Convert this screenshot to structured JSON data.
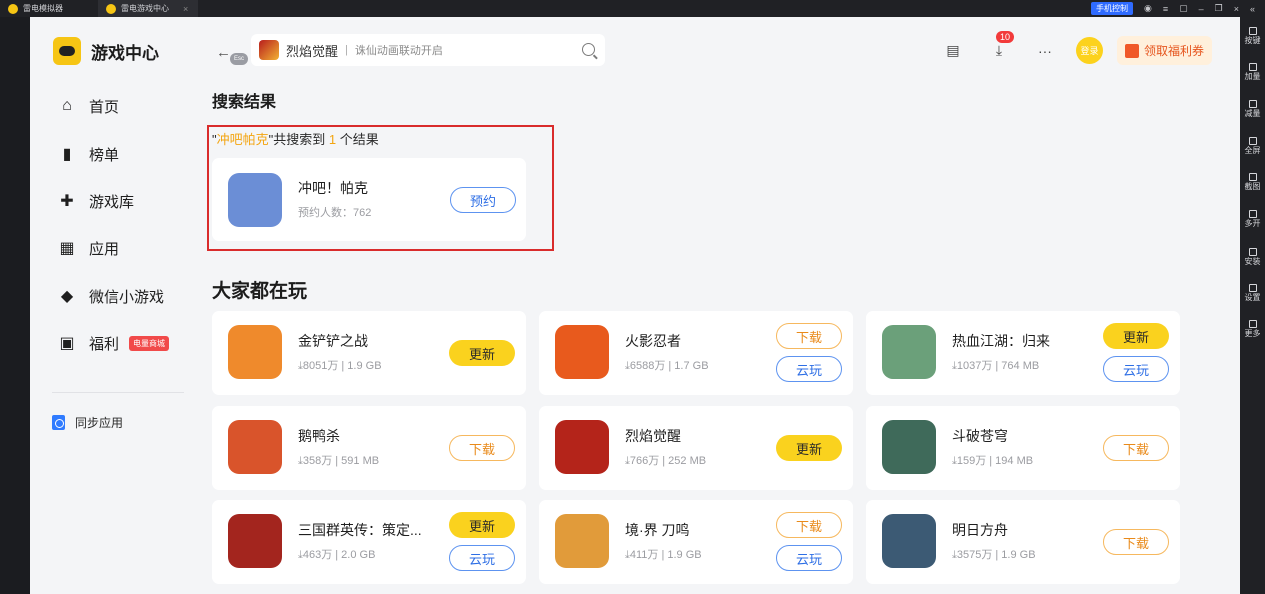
{
  "titlebar": {
    "tab1": "雷电模拟器",
    "tab2": "雷电游戏中心",
    "phone_control": "手机控制"
  },
  "rightbar": {
    "items": [
      "按键",
      "加量",
      "减量",
      "全屏",
      "截图",
      "多开",
      "安装",
      "设置",
      "更多"
    ]
  },
  "sidebar": {
    "brand": "游戏中心",
    "items": [
      {
        "label": "首页",
        "icon": "home-icon"
      },
      {
        "label": "榜单",
        "icon": "ranking-icon"
      },
      {
        "label": "游戏库",
        "icon": "gamepad-icon"
      },
      {
        "label": "应用",
        "icon": "apps-icon"
      },
      {
        "label": "微信小游戏",
        "icon": "wechat-game-icon"
      },
      {
        "label": "福利",
        "icon": "gift-icon",
        "badge": "电量商城"
      }
    ],
    "sync_label": "同步应用"
  },
  "header": {
    "back_hint": "Esc",
    "search_game": "烈焰觉醒",
    "search_divider": "|",
    "search_sub": "诛仙动画联动开启",
    "download_count": "10",
    "login_label": "登录",
    "welfare_label": "领取福利券"
  },
  "search_results": {
    "title": "搜索结果",
    "note_prefix": "\"",
    "query": "冲吧帕克",
    "note_mid": "\"共搜索到 ",
    "count": "1",
    "note_suffix": " 个结果",
    "item": {
      "name": "冲吧！帕克",
      "meta": "预约人数：762",
      "button": "预约",
      "icon_color": "#6b8ed6"
    }
  },
  "popular": {
    "title": "大家都在玩",
    "games": [
      {
        "name": "金铲铲之战",
        "meta": "⤓8051万 | 1.9 GB",
        "buttons": [
          "更新"
        ],
        "color": "#ef8a2c"
      },
      {
        "name": "火影忍者",
        "meta": "⤓6588万 | 1.7 GB",
        "buttons": [
          "下载",
          "云玩"
        ],
        "color": "#e85a1d"
      },
      {
        "name": "热血江湖：归来",
        "meta": "⤓1037万 | 764 MB",
        "buttons": [
          "更新",
          "云玩"
        ],
        "color": "#6ba07a"
      },
      {
        "name": "鹅鸭杀",
        "meta": "⤓358万 | 591 MB",
        "buttons": [
          "下载"
        ],
        "color": "#d9542b"
      },
      {
        "name": "烈焰觉醒",
        "meta": "⤓766万 | 252 MB",
        "buttons": [
          "更新"
        ],
        "color": "#b4241a"
      },
      {
        "name": "斗破苍穹",
        "meta": "⤓159万 | 194 MB",
        "buttons": [
          "下载"
        ],
        "color": "#3f6a5a"
      },
      {
        "name": "三国群英传：策定...",
        "meta": "⤓463万 | 2.0 GB",
        "buttons": [
          "更新",
          "云玩"
        ],
        "color": "#a3251e"
      },
      {
        "name": "境·界 刀鸣",
        "meta": "⤓411万 | 1.9 GB",
        "buttons": [
          "下载",
          "云玩"
        ],
        "color": "#e19b3a"
      },
      {
        "name": "明日方舟",
        "meta": "⤓3575万 | 1.9 GB",
        "buttons": [
          "下载"
        ],
        "color": "#3c5a74"
      }
    ]
  }
}
